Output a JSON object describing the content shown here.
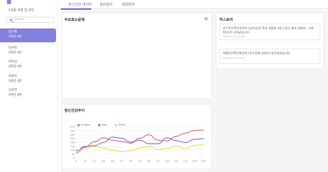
{
  "sidebar": {
    "subtitle": "구성원 조회 및 관리",
    "search": {
      "placeholder": "Search..."
    },
    "students": [
      {
        "name": "엄다혜",
        "grade": "3학년 4반",
        "active": true
      },
      {
        "name": "진서진",
        "grade": "3학년 4반",
        "active": false
      },
      {
        "name": "이아심",
        "grade": "3학년 4반",
        "active": false
      },
      {
        "name": "서현석",
        "grade": "3학년 4반",
        "active": false
      },
      {
        "name": "고유한",
        "grade": "3학년 4반",
        "active": false
      }
    ]
  },
  "tabs": [
    {
      "label": "정신건강 데이터",
      "active": true
    },
    {
      "label": "심리검사",
      "active": false
    },
    {
      "label": "상담관리",
      "active": false
    }
  ],
  "main": {
    "problems_title": "주요호소문제",
    "history_title": "히스토리",
    "history": [
      {
        "text": "손수민(2학년3반)의 [심리검사] 학교 위험링 척도] 검사 결과 [위험도: 고위험]으로 나타났습니다.",
        "time": "2023-07-11 12:04"
      },
      {
        "text": "박통찬(3학년4반)의 [호소문제 자살]가 발견되었습니다.",
        "time": "2023-07-11 12:04"
      }
    ],
    "trend_title": "정신건강추이"
  },
  "colors": {
    "accent": "#6b66d8",
    "europe": "#d9534f",
    "asia": "#5b5bd6",
    "africa": "#f0d43a"
  },
  "chart_data": {
    "type": "line",
    "x": [
      0,
      10,
      20,
      30,
      40,
      50,
      60,
      70,
      80,
      90,
      100,
      110,
      120,
      130,
      140
    ],
    "ylim": [
      0,
      400
    ],
    "yticks": [
      0,
      50,
      100,
      150,
      200,
      250,
      300,
      350,
      400
    ],
    "series": [
      {
        "name": "Europe",
        "values": [
          70,
          140,
          210,
          260,
          230,
          215,
          190,
          255,
          300,
          230,
          220,
          280,
          320,
          355,
          360
        ]
      },
      {
        "name": "Asia",
        "values": [
          95,
          150,
          160,
          200,
          270,
          255,
          205,
          230,
          185,
          185,
          260,
          225,
          200,
          240,
          250
        ]
      },
      {
        "name": "Africa",
        "values": [
          105,
          120,
          150,
          130,
          100,
          85,
          95,
          130,
          150,
          110,
          125,
          160,
          120,
          165,
          175
        ]
      }
    ]
  }
}
